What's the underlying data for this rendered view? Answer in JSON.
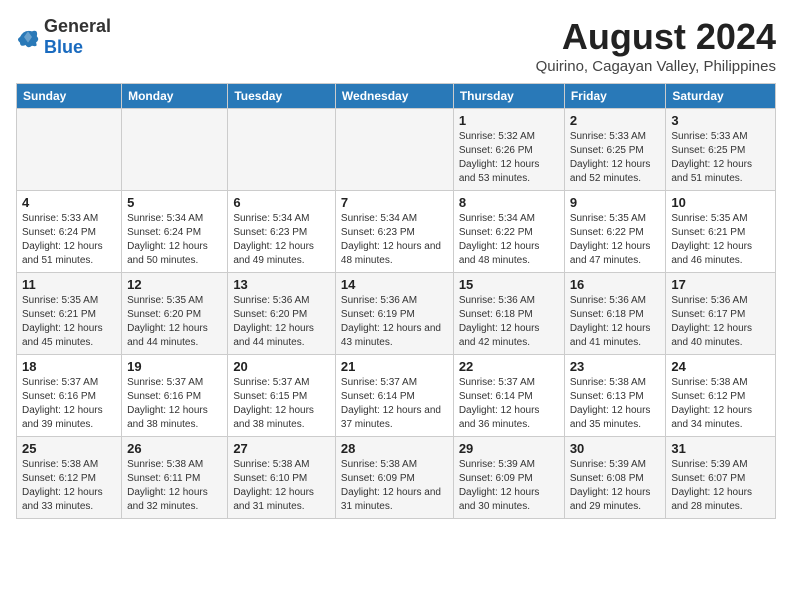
{
  "logo": {
    "general": "General",
    "blue": "Blue"
  },
  "title": "August 2024",
  "subtitle": "Quirino, Cagayan Valley, Philippines",
  "days_of_week": [
    "Sunday",
    "Monday",
    "Tuesday",
    "Wednesday",
    "Thursday",
    "Friday",
    "Saturday"
  ],
  "weeks": [
    [
      {
        "day": "",
        "sunrise": "",
        "sunset": "",
        "daylight": ""
      },
      {
        "day": "",
        "sunrise": "",
        "sunset": "",
        "daylight": ""
      },
      {
        "day": "",
        "sunrise": "",
        "sunset": "",
        "daylight": ""
      },
      {
        "day": "",
        "sunrise": "",
        "sunset": "",
        "daylight": ""
      },
      {
        "day": "1",
        "sunrise": "Sunrise: 5:32 AM",
        "sunset": "Sunset: 6:26 PM",
        "daylight": "Daylight: 12 hours and 53 minutes."
      },
      {
        "day": "2",
        "sunrise": "Sunrise: 5:33 AM",
        "sunset": "Sunset: 6:25 PM",
        "daylight": "Daylight: 12 hours and 52 minutes."
      },
      {
        "day": "3",
        "sunrise": "Sunrise: 5:33 AM",
        "sunset": "Sunset: 6:25 PM",
        "daylight": "Daylight: 12 hours and 51 minutes."
      }
    ],
    [
      {
        "day": "4",
        "sunrise": "Sunrise: 5:33 AM",
        "sunset": "Sunset: 6:24 PM",
        "daylight": "Daylight: 12 hours and 51 minutes."
      },
      {
        "day": "5",
        "sunrise": "Sunrise: 5:34 AM",
        "sunset": "Sunset: 6:24 PM",
        "daylight": "Daylight: 12 hours and 50 minutes."
      },
      {
        "day": "6",
        "sunrise": "Sunrise: 5:34 AM",
        "sunset": "Sunset: 6:23 PM",
        "daylight": "Daylight: 12 hours and 49 minutes."
      },
      {
        "day": "7",
        "sunrise": "Sunrise: 5:34 AM",
        "sunset": "Sunset: 6:23 PM",
        "daylight": "Daylight: 12 hours and 48 minutes."
      },
      {
        "day": "8",
        "sunrise": "Sunrise: 5:34 AM",
        "sunset": "Sunset: 6:22 PM",
        "daylight": "Daylight: 12 hours and 48 minutes."
      },
      {
        "day": "9",
        "sunrise": "Sunrise: 5:35 AM",
        "sunset": "Sunset: 6:22 PM",
        "daylight": "Daylight: 12 hours and 47 minutes."
      },
      {
        "day": "10",
        "sunrise": "Sunrise: 5:35 AM",
        "sunset": "Sunset: 6:21 PM",
        "daylight": "Daylight: 12 hours and 46 minutes."
      }
    ],
    [
      {
        "day": "11",
        "sunrise": "Sunrise: 5:35 AM",
        "sunset": "Sunset: 6:21 PM",
        "daylight": "Daylight: 12 hours and 45 minutes."
      },
      {
        "day": "12",
        "sunrise": "Sunrise: 5:35 AM",
        "sunset": "Sunset: 6:20 PM",
        "daylight": "Daylight: 12 hours and 44 minutes."
      },
      {
        "day": "13",
        "sunrise": "Sunrise: 5:36 AM",
        "sunset": "Sunset: 6:20 PM",
        "daylight": "Daylight: 12 hours and 44 minutes."
      },
      {
        "day": "14",
        "sunrise": "Sunrise: 5:36 AM",
        "sunset": "Sunset: 6:19 PM",
        "daylight": "Daylight: 12 hours and 43 minutes."
      },
      {
        "day": "15",
        "sunrise": "Sunrise: 5:36 AM",
        "sunset": "Sunset: 6:18 PM",
        "daylight": "Daylight: 12 hours and 42 minutes."
      },
      {
        "day": "16",
        "sunrise": "Sunrise: 5:36 AM",
        "sunset": "Sunset: 6:18 PM",
        "daylight": "Daylight: 12 hours and 41 minutes."
      },
      {
        "day": "17",
        "sunrise": "Sunrise: 5:36 AM",
        "sunset": "Sunset: 6:17 PM",
        "daylight": "Daylight: 12 hours and 40 minutes."
      }
    ],
    [
      {
        "day": "18",
        "sunrise": "Sunrise: 5:37 AM",
        "sunset": "Sunset: 6:16 PM",
        "daylight": "Daylight: 12 hours and 39 minutes."
      },
      {
        "day": "19",
        "sunrise": "Sunrise: 5:37 AM",
        "sunset": "Sunset: 6:16 PM",
        "daylight": "Daylight: 12 hours and 38 minutes."
      },
      {
        "day": "20",
        "sunrise": "Sunrise: 5:37 AM",
        "sunset": "Sunset: 6:15 PM",
        "daylight": "Daylight: 12 hours and 38 minutes."
      },
      {
        "day": "21",
        "sunrise": "Sunrise: 5:37 AM",
        "sunset": "Sunset: 6:14 PM",
        "daylight": "Daylight: 12 hours and 37 minutes."
      },
      {
        "day": "22",
        "sunrise": "Sunrise: 5:37 AM",
        "sunset": "Sunset: 6:14 PM",
        "daylight": "Daylight: 12 hours and 36 minutes."
      },
      {
        "day": "23",
        "sunrise": "Sunrise: 5:38 AM",
        "sunset": "Sunset: 6:13 PM",
        "daylight": "Daylight: 12 hours and 35 minutes."
      },
      {
        "day": "24",
        "sunrise": "Sunrise: 5:38 AM",
        "sunset": "Sunset: 6:12 PM",
        "daylight": "Daylight: 12 hours and 34 minutes."
      }
    ],
    [
      {
        "day": "25",
        "sunrise": "Sunrise: 5:38 AM",
        "sunset": "Sunset: 6:12 PM",
        "daylight": "Daylight: 12 hours and 33 minutes."
      },
      {
        "day": "26",
        "sunrise": "Sunrise: 5:38 AM",
        "sunset": "Sunset: 6:11 PM",
        "daylight": "Daylight: 12 hours and 32 minutes."
      },
      {
        "day": "27",
        "sunrise": "Sunrise: 5:38 AM",
        "sunset": "Sunset: 6:10 PM",
        "daylight": "Daylight: 12 hours and 31 minutes."
      },
      {
        "day": "28",
        "sunrise": "Sunrise: 5:38 AM",
        "sunset": "Sunset: 6:09 PM",
        "daylight": "Daylight: 12 hours and 31 minutes."
      },
      {
        "day": "29",
        "sunrise": "Sunrise: 5:39 AM",
        "sunset": "Sunset: 6:09 PM",
        "daylight": "Daylight: 12 hours and 30 minutes."
      },
      {
        "day": "30",
        "sunrise": "Sunrise: 5:39 AM",
        "sunset": "Sunset: 6:08 PM",
        "daylight": "Daylight: 12 hours and 29 minutes."
      },
      {
        "day": "31",
        "sunrise": "Sunrise: 5:39 AM",
        "sunset": "Sunset: 6:07 PM",
        "daylight": "Daylight: 12 hours and 28 minutes."
      }
    ]
  ]
}
